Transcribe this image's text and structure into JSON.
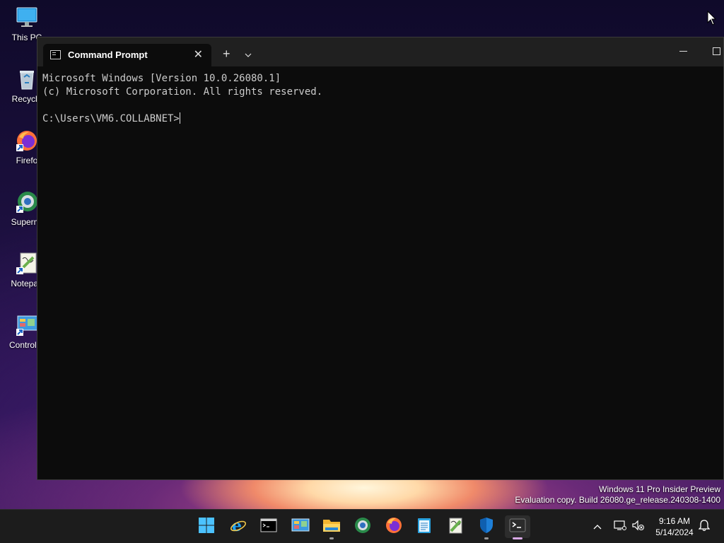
{
  "desktop": {
    "icons": [
      {
        "label": "This PC",
        "icon": "monitor-icon"
      },
      {
        "label": "Recycle",
        "icon": "recycle-bin-icon"
      },
      {
        "label": "Firefo",
        "icon": "firefox-icon"
      },
      {
        "label": "Supermi",
        "icon": "supermium-icon"
      },
      {
        "label": "Notepad",
        "icon": "notepad-plus-plus-icon"
      },
      {
        "label": "Control P",
        "icon": "control-panel-icon"
      }
    ]
  },
  "window": {
    "tab_title": "Command Prompt",
    "close_glyph": "✕",
    "new_tab_glyph": "+",
    "terminal_lines": [
      "Microsoft Windows [Version 10.0.26080.1]",
      "(c) Microsoft Corporation. All rights reserved.",
      "",
      "C:\\Users\\VM6.COLLABNET>"
    ]
  },
  "watermark": {
    "line1": "Windows 11 Pro Insider Preview",
    "line2": "Evaluation copy. Build 26080.ge_release.240308-1400"
  },
  "taskbar": {
    "apps": [
      {
        "name": "start",
        "icon": "windows-logo-icon"
      },
      {
        "name": "internet-explorer",
        "icon": "internet-explorer-icon"
      },
      {
        "name": "command-prompt",
        "icon": "command-prompt-icon"
      },
      {
        "name": "control-panel",
        "icon": "control-panel-icon"
      },
      {
        "name": "file-explorer",
        "icon": "folder-icon"
      },
      {
        "name": "supermium",
        "icon": "supermium-icon"
      },
      {
        "name": "firefox",
        "icon": "firefox-icon"
      },
      {
        "name": "notepad",
        "icon": "notepad-icon"
      },
      {
        "name": "notepad-plus-plus",
        "icon": "notepad-plus-plus-icon"
      },
      {
        "name": "windows-security",
        "icon": "shield-icon"
      },
      {
        "name": "terminal",
        "icon": "terminal-icon"
      }
    ],
    "clock": {
      "time": "9:16 AM",
      "date": "5/14/2024"
    }
  },
  "colors": {
    "terminal_bg": "#0c0c0c",
    "titlebar_bg": "#202020",
    "taskbar_bg": "#1c1c1c",
    "terminal_text": "#cccccc",
    "active_indicator": "#d9a9e6"
  }
}
